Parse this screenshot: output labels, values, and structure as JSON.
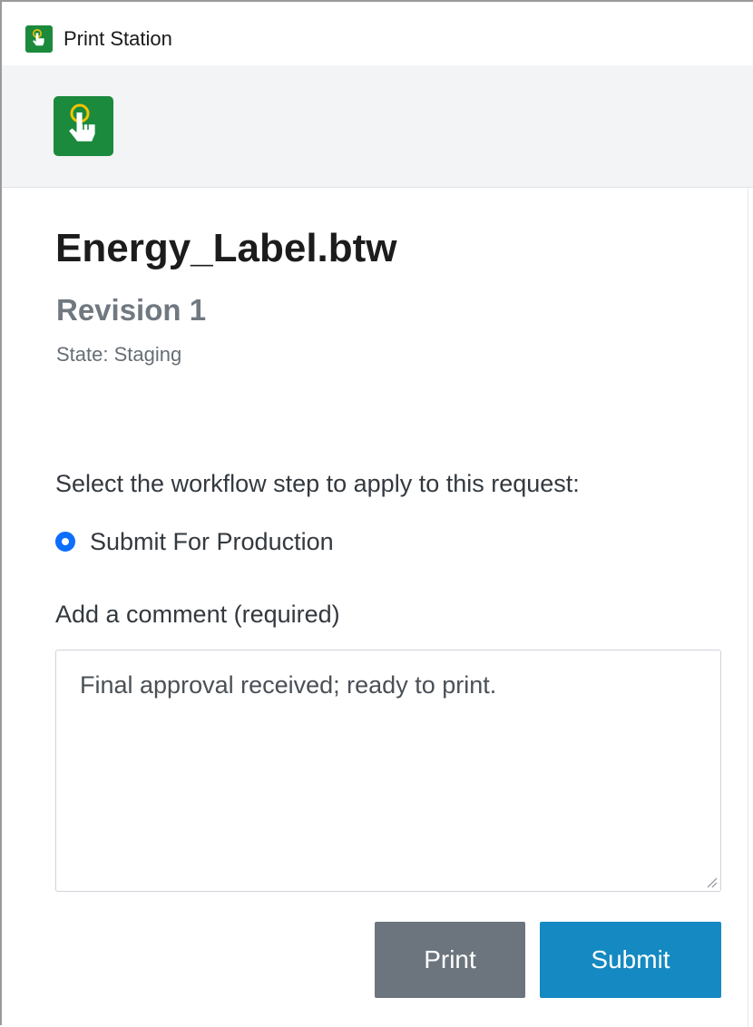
{
  "window": {
    "title": "Print Station",
    "title_icon": "touch-print-icon"
  },
  "header": {
    "logo_icon": "touch-print-logo-icon",
    "logo_color": "#1b8a3d"
  },
  "document": {
    "title": "Energy_Label.btw",
    "revision": "Revision 1",
    "state": "State: Staging"
  },
  "workflow": {
    "prompt": "Select the workflow step to apply to this request:",
    "options": [
      {
        "label": "Submit For Production",
        "selected": true
      }
    ]
  },
  "comment": {
    "label": "Add a comment (required)",
    "value": "Final approval received; ready to print."
  },
  "actions": {
    "print_label": "Print",
    "submit_label": "Submit",
    "print_color": "#6c757d",
    "submit_color": "#1589c1"
  }
}
